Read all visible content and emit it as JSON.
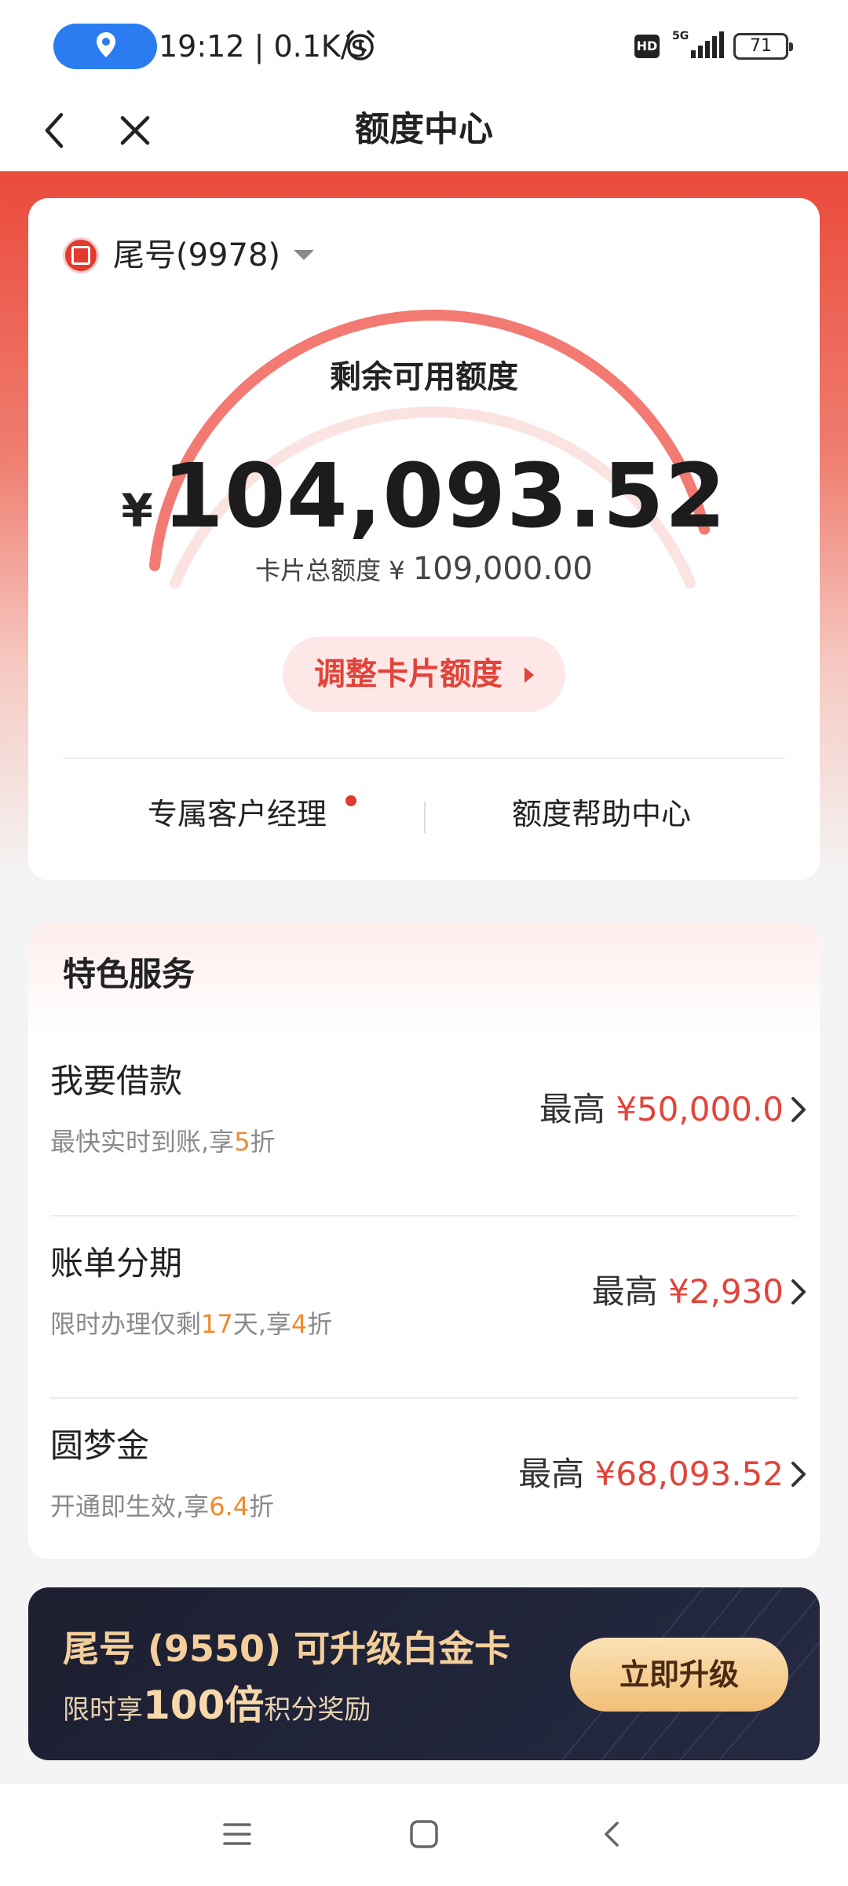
{
  "status_bar": {
    "time_speed": "19:12 | 0.1K/s",
    "hd": "HD",
    "network": "5G",
    "battery": "71"
  },
  "nav": {
    "title": "额度中心"
  },
  "card": {
    "selector_label": "尾号(9978)",
    "remaining_label": "剩余可用额度",
    "currency": "¥",
    "remaining_amount": "104,093.52",
    "total_label": "卡片总额度 ¥",
    "total_amount": "109,000.00",
    "remaining_fraction": 0.955,
    "adjust_button": "调整卡片额度",
    "link_manager": "专属客户经理",
    "link_help": "额度帮助中心"
  },
  "services": {
    "title": "特色服务",
    "items": [
      {
        "name": "我要借款",
        "desc_before": "最快实时到账,享",
        "desc_hl1": "5",
        "desc_mid": "折",
        "desc_hl2": "",
        "desc_after": "",
        "prefix": "最高",
        "value": "¥50,000.0"
      },
      {
        "name": "账单分期",
        "desc_before": "限时办理仅剩",
        "desc_hl1": "17",
        "desc_mid": "天,享",
        "desc_hl2": "4",
        "desc_after": "折",
        "prefix": "最高",
        "value": "¥2,930"
      },
      {
        "name": "圆梦金",
        "desc_before": "开通即生效,享",
        "desc_hl1": "6.4",
        "desc_mid": "折",
        "desc_hl2": "",
        "desc_after": "",
        "prefix": "最高",
        "value": "¥68,093.52"
      }
    ]
  },
  "upgrade": {
    "title": "尾号 (9550) 可升级白金卡",
    "sub_before": "限时享",
    "sub_big": "100倍",
    "sub_after": "积分奖励",
    "button": "立即升级"
  },
  "colors": {
    "brand_red": "#e2443a",
    "highlight_orange": "#ef8a2c",
    "banner_gold": "#f4cf9b"
  },
  "icons": [
    "location-icon",
    "alarm-icon",
    "signal-icon",
    "back-icon",
    "close-icon",
    "caret-down-icon",
    "chevron-right-icon",
    "menu-icon",
    "home-icon",
    "system-back-icon"
  ]
}
